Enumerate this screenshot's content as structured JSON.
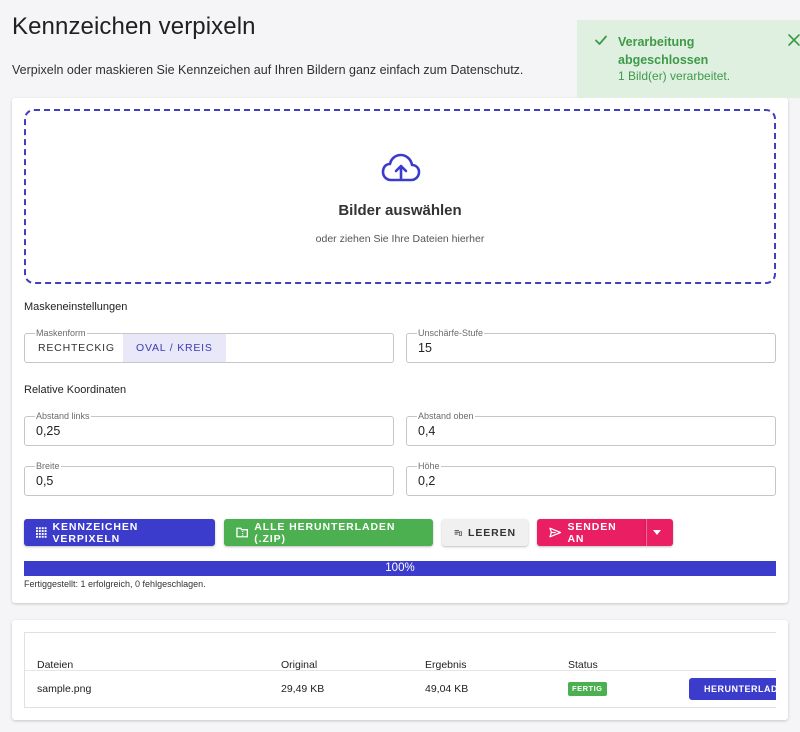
{
  "page": {
    "title": "Kennzeichen verpixeln",
    "subtitle": "Verpixeln oder maskieren Sie Kennzeichen auf Ihren Bildern ganz einfach zum Datenschutz."
  },
  "toast": {
    "title": "Verarbeitung abgeschlossen",
    "message": "1 Bild(er) verarbeitet.",
    "color": "#3f9a48",
    "background": "#dff0e1"
  },
  "dropzone": {
    "title": "Bilder auswählen",
    "subtitle": "oder ziehen Sie Ihre Dateien hierher",
    "icon": "cloud-upload-icon"
  },
  "mask_settings": {
    "heading": "Maskeneinstellungen",
    "shape_label": "Maskenform",
    "shape_options": [
      "RECHTECKIG",
      "OVAL / KREIS"
    ],
    "shape_selected": "OVAL / KREIS",
    "blur_label": "Unschärfe-Stufe",
    "blur_value": "15"
  },
  "coordinates": {
    "heading": "Relative Koordinaten",
    "left_label": "Abstand links",
    "left_value": "0,25",
    "top_label": "Abstand oben",
    "top_value": "0,4",
    "width_label": "Breite",
    "width_value": "0,5",
    "height_label": "Höhe",
    "height_value": "0,2"
  },
  "actions": {
    "pixelate": "KENNZEICHEN VERPIXELN",
    "download_all": "ALLE HERUNTERLADEN (.ZIP)",
    "clear": "LEEREN",
    "send": "SENDEN AN"
  },
  "progress": {
    "value": 100,
    "label": "100%",
    "note": "Fertiggestellt: 1 erfolgreich, 0 fehlgeschlagen."
  },
  "table": {
    "headers": [
      "Dateien",
      "Original",
      "Ergebnis",
      "Status"
    ],
    "rows": [
      {
        "file": "sample.png",
        "original": "29,49 KB",
        "result": "49,04 KB",
        "status": "FERTIG",
        "action": "HERUNTERLADEN"
      }
    ]
  },
  "colors": {
    "primary": "#3b3bcc",
    "success": "#4caf50",
    "accent": "#e91e63"
  }
}
